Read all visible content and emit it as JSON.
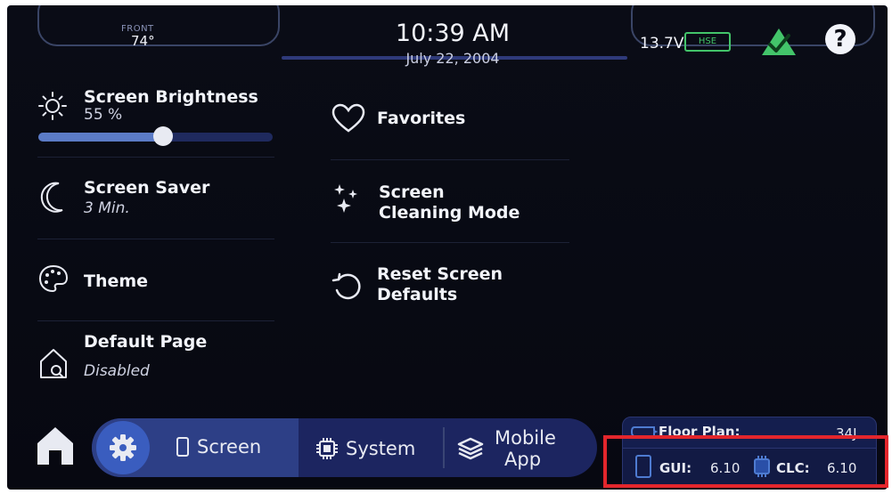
{
  "status": {
    "front_label": "FRONT",
    "front_temp": "74°",
    "time": "10:39 AM",
    "date": "July 22, 2004",
    "voltage": "13.7V",
    "battery_badge": "HSE",
    "help_symbol": "?"
  },
  "settings": {
    "brightness": {
      "title": "Screen Brightness",
      "value": "55 %",
      "level": 0.55
    },
    "screen_saver": {
      "title": "Screen Saver",
      "value": "3 Min."
    },
    "theme": {
      "title": "Theme"
    },
    "default_page": {
      "title": "Default Page",
      "value": "Disabled"
    },
    "favorites": {
      "title": "Favorites"
    },
    "cleaning_mode": {
      "title_line1": "Screen",
      "title_line2": "Cleaning Mode"
    },
    "reset_defaults": {
      "title_line1": "Reset Screen",
      "title_line2": "Defaults"
    }
  },
  "nav": {
    "screen_label": "Screen",
    "system_label": "System",
    "mobile_line1": "Mobile",
    "mobile_line2": "App"
  },
  "info": {
    "floor_plan_label": "Floor Plan:",
    "floor_plan_value": "34J",
    "gui_label": "GUI:",
    "gui_value": "6.10",
    "clc_label": "CLC:",
    "clc_value": "6.10"
  },
  "colors": {
    "accent": "#3a5dbf",
    "status_ok": "#43c46a",
    "highlight": "#e3262c"
  }
}
